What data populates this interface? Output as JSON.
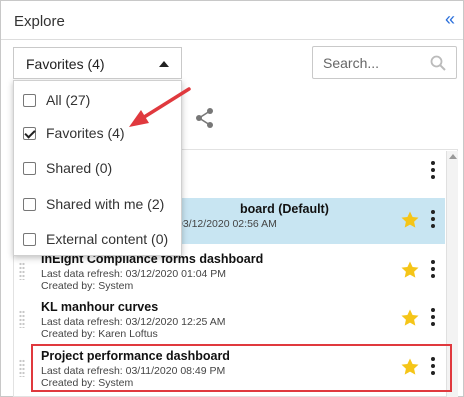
{
  "header": {
    "title": "Explore",
    "collapse_icon": "double-chevron-left-icon"
  },
  "filter": {
    "selected_label": "Favorites (4)",
    "options": [
      {
        "label": "All (27)",
        "checked": false
      },
      {
        "label": "Favorites (4)",
        "checked": true
      },
      {
        "label": "Shared (0)",
        "checked": false
      },
      {
        "label": "Shared with me (2)",
        "checked": false
      },
      {
        "label": "External content (0)",
        "checked": false
      }
    ]
  },
  "search": {
    "placeholder": "Search..."
  },
  "dashboards": [
    {
      "name": "board (Default)",
      "refresh": "03/12/2020 02:56 AM",
      "created_by": "",
      "favorite": true,
      "selected": true
    },
    {
      "name": "InEight Compliance forms dashboard",
      "refresh": "Last data refresh: 03/12/2020 01:04 PM",
      "created_by": "Created by: System",
      "favorite": true,
      "selected": false
    },
    {
      "name": "KL manhour curves",
      "refresh": "Last data refresh: 03/12/2020 12:25 AM",
      "created_by": "Created by: Karen Loftus",
      "favorite": true,
      "selected": false
    },
    {
      "name": "Project performance dashboard",
      "refresh": "Last data refresh: 03/11/2020 08:49 PM",
      "created_by": "Created by: System",
      "favorite": true,
      "selected": false
    }
  ],
  "colors": {
    "accent": "#2a6fdb",
    "selected_row": "#c8e5f2",
    "star": "#f5c518",
    "annotation": "#e0393e"
  }
}
